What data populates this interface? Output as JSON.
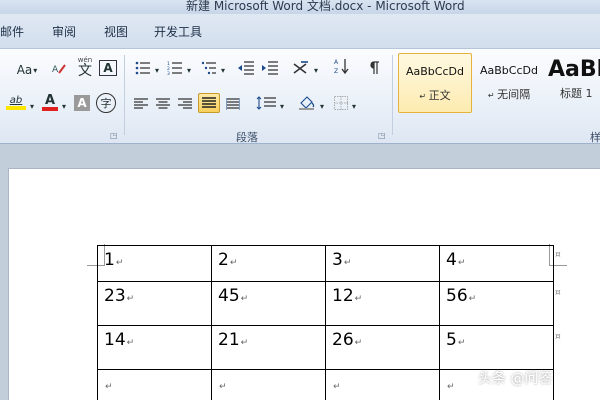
{
  "window": {
    "title": "新建 Microsoft Word 文档.docx - Microsoft Word"
  },
  "ribbon_tabs": [
    "邮件",
    "审阅",
    "视图",
    "开发工具"
  ],
  "font_group": {
    "change_case_label": "Aa",
    "phonetic_label": "文",
    "phonetic_top": "wén",
    "char_border_label": "A",
    "highlight_label": "ab",
    "font_color_label": "A",
    "char_shading_label": "A",
    "enclose_label": "字"
  },
  "paragraph_group": {
    "label": "段落"
  },
  "styles": [
    {
      "sample": "AaBbCcDd",
      "name": "正文",
      "selected": true
    },
    {
      "sample": "AaBbCcDd",
      "name": "无间隔",
      "selected": false
    },
    {
      "sample": "AaBl",
      "name": "标题 1",
      "selected": false
    }
  ],
  "styles_group_label": "样",
  "table": {
    "rows": [
      [
        "1",
        "2",
        "3",
        "4"
      ],
      [
        "23",
        "45",
        "12",
        "56"
      ],
      [
        "14",
        "21",
        "26",
        "5"
      ],
      [
        "",
        "",
        "",
        ""
      ]
    ],
    "paragraph_mark": "↵",
    "end_of_row_mark": "¤"
  },
  "watermark": "头条 @问答",
  "colors": {
    "highlight": "#ffe600",
    "font_color": "#e0201c",
    "active_align": "#f7cf5c"
  }
}
